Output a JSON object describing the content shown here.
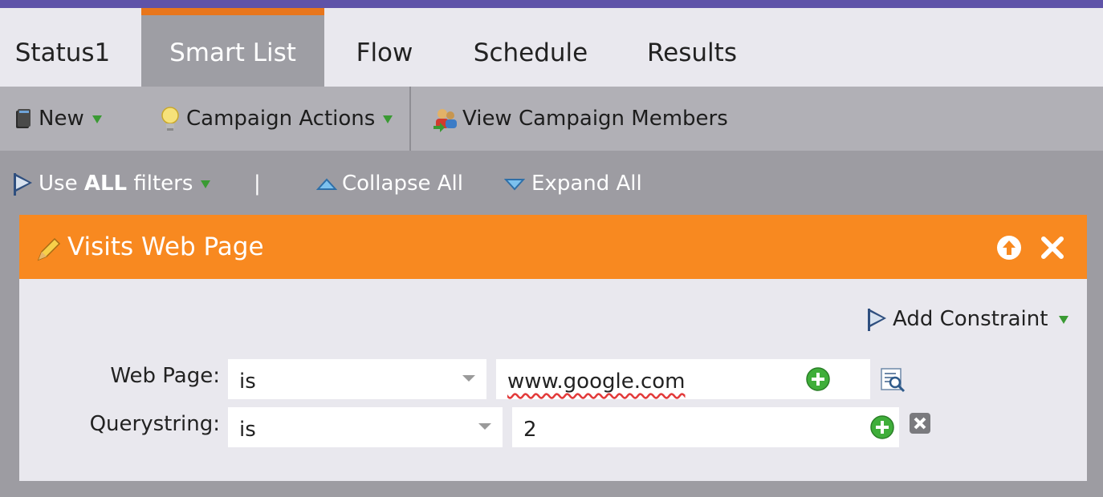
{
  "tabs": [
    {
      "label": "Status1",
      "active": false
    },
    {
      "label": "Smart List",
      "active": true
    },
    {
      "label": "Flow",
      "active": false
    },
    {
      "label": "Schedule",
      "active": false
    },
    {
      "label": "Results",
      "active": false
    }
  ],
  "toolbar": {
    "new_label": "New",
    "campaign_actions_label": "Campaign Actions",
    "view_members_label": "View Campaign Members"
  },
  "filterbar": {
    "use_prefix": "Use ",
    "use_bold": "ALL",
    "use_suffix": " filters",
    "separator": "|",
    "collapse_label": "Collapse All",
    "expand_label": "Expand All"
  },
  "filter": {
    "title": "Visits Web Page",
    "add_constraint_label": "Add Constraint",
    "rows": [
      {
        "label": "Web Page:",
        "operator": "is",
        "value": "www.google.com"
      },
      {
        "label": "Querystring:",
        "operator": "is",
        "value": "2"
      }
    ]
  },
  "colors": {
    "header_accent": "#5f53a8",
    "active_tab_border": "#e8761c",
    "filter_header": "#f88920",
    "add_green": "#3a9a33"
  },
  "icons": [
    "book-icon",
    "lightbulb-icon",
    "people-icon",
    "funnel-icon",
    "collapse-triangle-icon",
    "expand-triangle-icon",
    "pencil-icon",
    "move-up-icon",
    "close-icon",
    "plus-circle-icon",
    "lookup-icon",
    "remove-constraint-icon"
  ]
}
